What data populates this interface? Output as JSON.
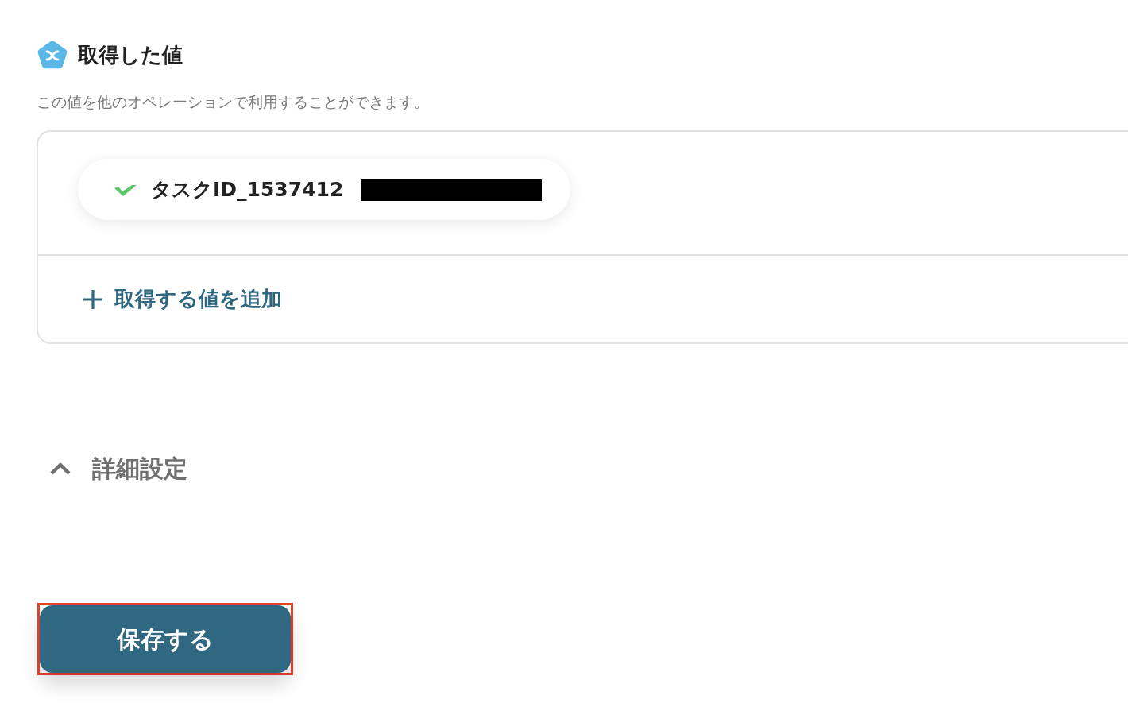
{
  "header": {
    "title": "取得した値",
    "description": "この値を他のオペレーションで利用することができます。"
  },
  "values": [
    {
      "label": "タスクID_1537412",
      "redacted": true
    }
  ],
  "add_value": {
    "label": "取得する値を追加"
  },
  "advanced": {
    "label": "詳細設定",
    "expanded": true
  },
  "save_button": {
    "label": "保存する",
    "highlighted": true
  }
}
